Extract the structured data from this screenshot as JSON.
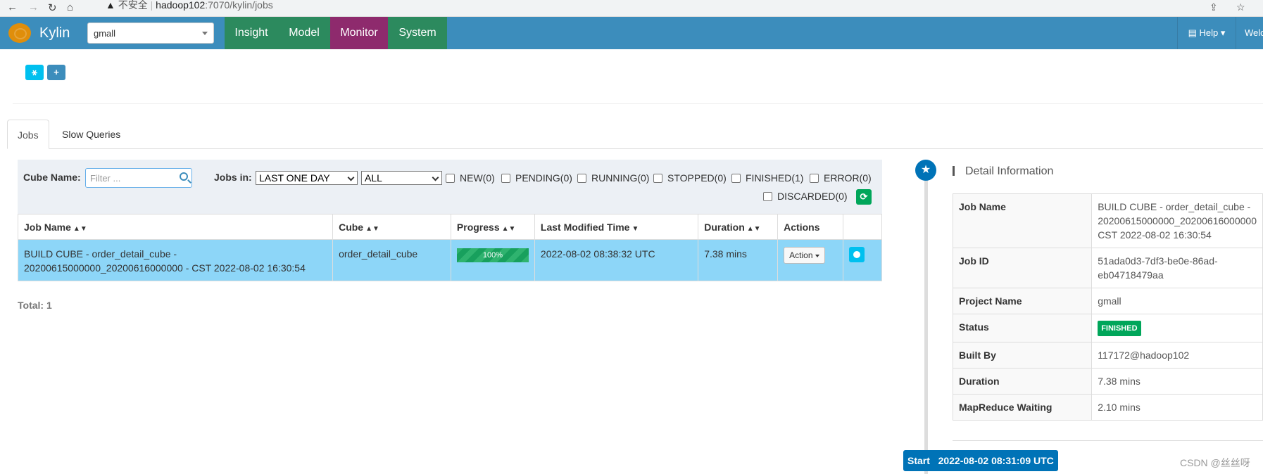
{
  "browser": {
    "security_warning": "不安全",
    "url_host": "hadoop102",
    "url_path": ":7070/kylin/jobs"
  },
  "topnav": {
    "brand": "Kylin",
    "project": "gmall",
    "tabs": [
      {
        "label": "Insight"
      },
      {
        "label": "Model"
      },
      {
        "label": "Monitor",
        "active": true
      },
      {
        "label": "System"
      }
    ],
    "help": "Help",
    "welcome": "Welc"
  },
  "page_tabs": [
    {
      "label": "Jobs",
      "active": true
    },
    {
      "label": "Slow Queries"
    }
  ],
  "filters": {
    "cube_name_label": "Cube Name:",
    "cube_name_placeholder": "Filter ...",
    "jobs_in_label": "Jobs in:",
    "time_range": "LAST ONE DAY",
    "job_scope": "ALL",
    "statuses": [
      "NEW(0)",
      "PENDING(0)",
      "RUNNING(0)",
      "STOPPED(0)",
      "FINISHED(1)",
      "ERROR(0)",
      "DISCARDED(0)"
    ]
  },
  "jobs_table": {
    "headers": [
      "Job Name",
      "Cube",
      "Progress",
      "Last Modified Time",
      "Duration",
      "Actions"
    ],
    "rows": [
      {
        "job_name_line1": "BUILD CUBE - order_detail_cube -",
        "job_name_line2": "20200615000000_20200616000000 - CST 2022-08-02 16:30:54",
        "cube": "order_detail_cube",
        "progress_label": "100%",
        "progress": 1.0,
        "last_modified": "2022-08-02 08:38:32 UTC",
        "duration": "7.38 mins",
        "action_label": "Action"
      }
    ]
  },
  "total": "Total: 1",
  "detail": {
    "title": "Detail Information",
    "rows": [
      {
        "key": "Job Name",
        "lines": [
          "BUILD CUBE - order_detail_cube -",
          "20200615000000_20200616000000",
          "CST 2022-08-02 16:30:54"
        ]
      },
      {
        "key": "Job ID",
        "lines": [
          "51ada0d3-7df3-be0e-86ad-",
          "eb04718479aa"
        ]
      },
      {
        "key": "Project Name",
        "lines": [
          "gmall"
        ]
      },
      {
        "key": "Status",
        "badge": "FINISHED"
      },
      {
        "key": "Built By",
        "lines": [
          "117172@hadoop102"
        ]
      },
      {
        "key": "Duration",
        "lines": [
          "7.38 mins"
        ]
      },
      {
        "key": "MapReduce Waiting",
        "lines": [
          "2.10 mins"
        ]
      }
    ]
  },
  "timeline": {
    "start_label": "Start",
    "start_time": "2022-08-02 08:31:09 UTC"
  },
  "watermark": "CSDN @丝丝呀",
  "colors": {
    "topnav": "#3c8dbc",
    "navtab": "#2c8a5e",
    "navtab_active": "#8e2a6d",
    "row_highlight": "#8dd6f8",
    "success": "#00a65a",
    "timeline": "#0073b7"
  }
}
